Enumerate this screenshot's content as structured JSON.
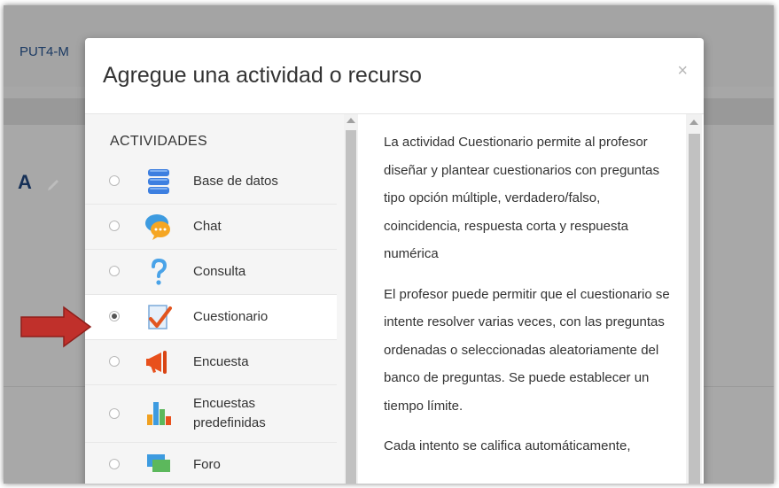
{
  "background": {
    "course_code": "PUT4-M",
    "letter": "A"
  },
  "modal": {
    "title": "Agregue una actividad o recurso",
    "close_symbol": "×"
  },
  "activities": {
    "section_title": "ACTIVIDADES",
    "items": [
      {
        "label": "Base de datos",
        "icon": "database-icon",
        "selected": false
      },
      {
        "label": "Chat",
        "icon": "chat-icon",
        "selected": false
      },
      {
        "label": "Consulta",
        "icon": "question-icon",
        "selected": false
      },
      {
        "label": "Cuestionario",
        "icon": "quiz-icon",
        "selected": true
      },
      {
        "label": "Encuesta",
        "icon": "megaphone-icon",
        "selected": false
      },
      {
        "label_line1": "Encuestas",
        "label_line2": "predefinidas",
        "icon": "bar-chart-icon",
        "selected": false
      },
      {
        "label": "Foro",
        "icon": "forum-icon",
        "selected": false
      }
    ]
  },
  "description": {
    "p1": "La actividad Cuestionario permite al profesor diseñar y plantear cuestionarios con preguntas tipo opción múltiple, verdadero/falso, coincidencia, respuesta corta y respuesta numérica",
    "p2": "El profesor puede permitir que el cuestionario se intente resolver varias veces, con las preguntas ordenadas o seleccionadas aleatoriamente del banco de preguntas. Se puede establecer un tiempo límite.",
    "p3": "Cada intento se califica automáticamente,"
  },
  "colors": {
    "annotation_arrow": "#c0302b",
    "overlay": "#a7a7a7"
  }
}
